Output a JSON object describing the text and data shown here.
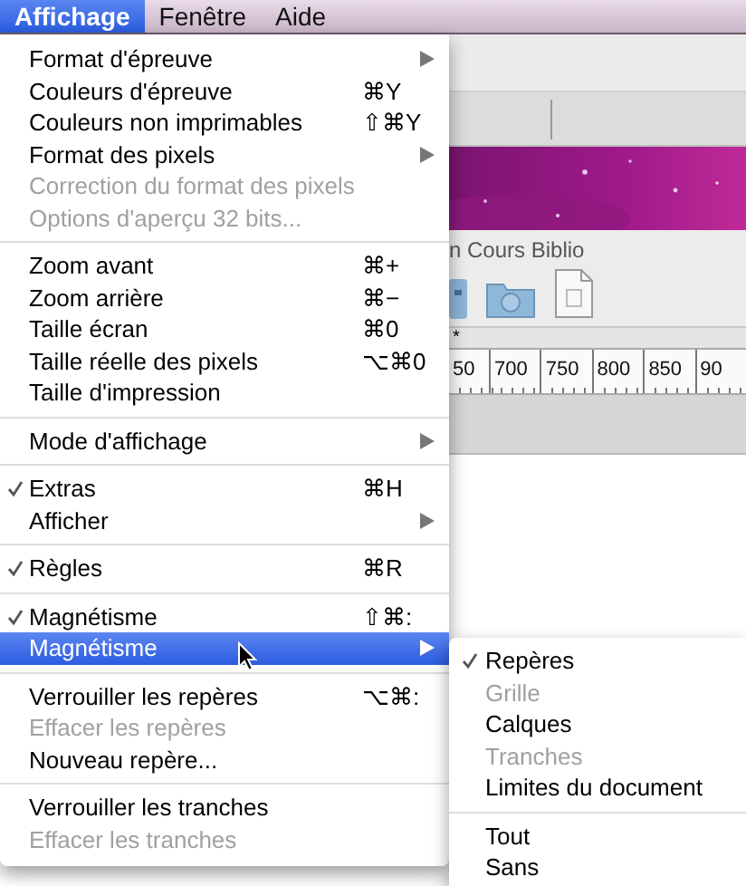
{
  "menu_bar": [
    {
      "label": "Affichage",
      "selected": true
    },
    {
      "label": "Fenêtre",
      "selected": false
    },
    {
      "label": "Aide",
      "selected": false
    }
  ],
  "background_window": {
    "title_fragment": "n Cours Biblio",
    "marker": "*",
    "ruler_labels": [
      "50",
      "700",
      "750",
      "800",
      "850",
      "90"
    ]
  },
  "menu": {
    "items": [
      {
        "kind": "item",
        "label": "Format d'épreuve",
        "checked": false,
        "disabled": false,
        "submenu": true,
        "selected": false
      },
      {
        "kind": "item",
        "label": "Couleurs d'épreuve",
        "shortcut": "⌘Y",
        "checked": false,
        "disabled": false,
        "submenu": false,
        "selected": false
      },
      {
        "kind": "item",
        "label": "Couleurs non imprimables",
        "shortcut": "⇧⌘Y",
        "checked": false,
        "disabled": false,
        "submenu": false,
        "selected": false
      },
      {
        "kind": "item",
        "label": "Format des pixels",
        "checked": false,
        "disabled": false,
        "submenu": true,
        "selected": false
      },
      {
        "kind": "item",
        "label": "Correction du format des pixels",
        "checked": false,
        "disabled": true,
        "submenu": false,
        "selected": false
      },
      {
        "kind": "item",
        "label": "Options d'aperçu 32 bits...",
        "checked": false,
        "disabled": true,
        "submenu": false,
        "selected": false
      },
      {
        "kind": "separator"
      },
      {
        "kind": "item",
        "label": "Zoom avant",
        "shortcut": "⌘+",
        "checked": false,
        "disabled": false,
        "submenu": false,
        "selected": false
      },
      {
        "kind": "item",
        "label": "Zoom arrière",
        "shortcut": "⌘−",
        "checked": false,
        "disabled": false,
        "submenu": false,
        "selected": false
      },
      {
        "kind": "item",
        "label": "Taille écran",
        "shortcut": "⌘0",
        "checked": false,
        "disabled": false,
        "submenu": false,
        "selected": false
      },
      {
        "kind": "item",
        "label": "Taille réelle des pixels",
        "shortcut": "⌥⌘0",
        "checked": false,
        "disabled": false,
        "submenu": false,
        "selected": false
      },
      {
        "kind": "item",
        "label": "Taille d'impression",
        "checked": false,
        "disabled": false,
        "submenu": false,
        "selected": false
      },
      {
        "kind": "separator"
      },
      {
        "kind": "item",
        "label": "Mode d'affichage",
        "checked": false,
        "disabled": false,
        "submenu": true,
        "selected": false
      },
      {
        "kind": "separator"
      },
      {
        "kind": "item",
        "label": "Extras",
        "shortcut": "⌘H",
        "checked": true,
        "disabled": false,
        "submenu": false,
        "selected": false
      },
      {
        "kind": "item",
        "label": "Afficher",
        "checked": false,
        "disabled": false,
        "submenu": true,
        "selected": false
      },
      {
        "kind": "separator"
      },
      {
        "kind": "item",
        "label": "Règles",
        "shortcut": "⌘R",
        "checked": true,
        "disabled": false,
        "submenu": false,
        "selected": false
      },
      {
        "kind": "separator"
      },
      {
        "kind": "item",
        "label": "Magnétisme",
        "shortcut": "⇧⌘:",
        "checked": true,
        "disabled": false,
        "submenu": false,
        "selected": false
      },
      {
        "kind": "item",
        "label": "Magnétisme",
        "checked": false,
        "disabled": false,
        "submenu": true,
        "selected": true
      },
      {
        "kind": "separator"
      },
      {
        "kind": "item",
        "label": "Verrouiller les repères",
        "shortcut": "⌥⌘:",
        "checked": false,
        "disabled": false,
        "submenu": false,
        "selected": false
      },
      {
        "kind": "item",
        "label": "Effacer les repères",
        "checked": false,
        "disabled": true,
        "submenu": false,
        "selected": false
      },
      {
        "kind": "item",
        "label": "Nouveau repère...",
        "checked": false,
        "disabled": false,
        "submenu": false,
        "selected": false
      },
      {
        "kind": "separator"
      },
      {
        "kind": "item",
        "label": "Verrouiller les tranches",
        "checked": false,
        "disabled": false,
        "submenu": false,
        "selected": false
      },
      {
        "kind": "item",
        "label": "Effacer les tranches",
        "checked": false,
        "disabled": true,
        "submenu": false,
        "selected": false
      }
    ]
  },
  "submenu": {
    "items": [
      {
        "kind": "item",
        "label": "Repères",
        "checked": true,
        "disabled": false
      },
      {
        "kind": "item",
        "label": "Grille",
        "checked": false,
        "disabled": true
      },
      {
        "kind": "item",
        "label": "Calques",
        "checked": false,
        "disabled": false
      },
      {
        "kind": "item",
        "label": "Tranches",
        "checked": false,
        "disabled": true
      },
      {
        "kind": "item",
        "label": "Limites du document",
        "checked": false,
        "disabled": false
      },
      {
        "kind": "separator"
      },
      {
        "kind": "item",
        "label": "Tout",
        "checked": false,
        "disabled": false
      },
      {
        "kind": "item",
        "label": "Sans",
        "checked": false,
        "disabled": false
      }
    ]
  }
}
